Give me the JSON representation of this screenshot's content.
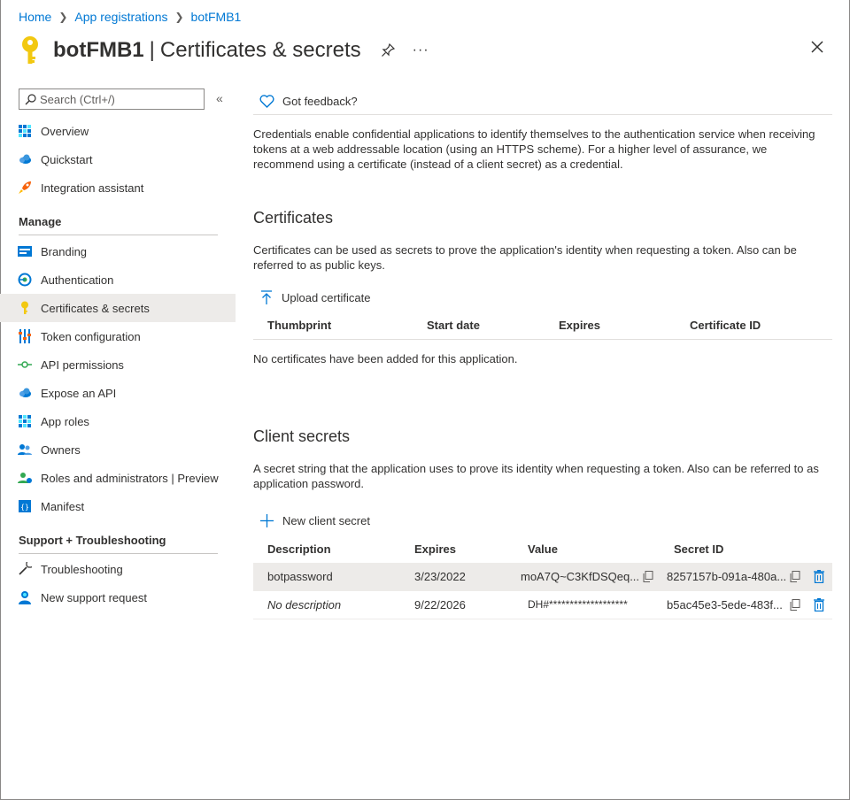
{
  "breadcrumb": [
    "Home",
    "App registrations",
    "botFMB1"
  ],
  "header": {
    "app_name": "botFMB1",
    "divider": "|",
    "page_title": "Certificates & secrets",
    "more": "···"
  },
  "sidebar": {
    "search_placeholder": "Search (Ctrl+/)",
    "collapse": "«",
    "items_top": [
      "Overview",
      "Quickstart",
      "Integration assistant"
    ],
    "manage_header": "Manage",
    "items_manage": [
      "Branding",
      "Authentication",
      "Certificates & secrets",
      "Token configuration",
      "API permissions",
      "Expose an API",
      "App roles",
      "Owners",
      "Roles and administrators | Preview",
      "Manifest"
    ],
    "support_header": "Support + Troubleshooting",
    "items_support": [
      "Troubleshooting",
      "New support request"
    ]
  },
  "main": {
    "feedback": "Got feedback?",
    "intro": "Credentials enable confidential applications to identify themselves to the authentication service when receiving tokens at a web addressable location (using an HTTPS scheme). For a higher level of assurance, we recommend using a certificate (instead of a client secret) as a credential.",
    "certificates": {
      "title": "Certificates",
      "description": "Certificates can be used as secrets to prove the application's identity when requesting a token. Also can be referred to as public keys.",
      "upload": "Upload certificate",
      "columns": [
        "Thumbprint",
        "Start date",
        "Expires",
        "Certificate ID"
      ],
      "empty": "No certificates have been added for this application."
    },
    "secrets": {
      "title": "Client secrets",
      "description": "A secret string that the application uses to prove its identity when requesting a token. Also can be referred to as application password.",
      "new": "New client secret",
      "columns": [
        "Description",
        "Expires",
        "Value",
        "Secret ID"
      ],
      "rows": [
        {
          "description": "botpassword",
          "expires": "3/23/2022",
          "value": "moA7Q~C3KfDSQeq...",
          "secret_id": "8257157b-091a-480a..."
        },
        {
          "description": "No description",
          "expires": "9/22/2026",
          "value": "DH#*******************",
          "secret_id": "b5ac45e3-5ede-483f..."
        }
      ]
    }
  },
  "colors": {
    "accent": "#0078d4",
    "key_yellow": "#f2c811",
    "selected_bg": "#edebe9"
  }
}
